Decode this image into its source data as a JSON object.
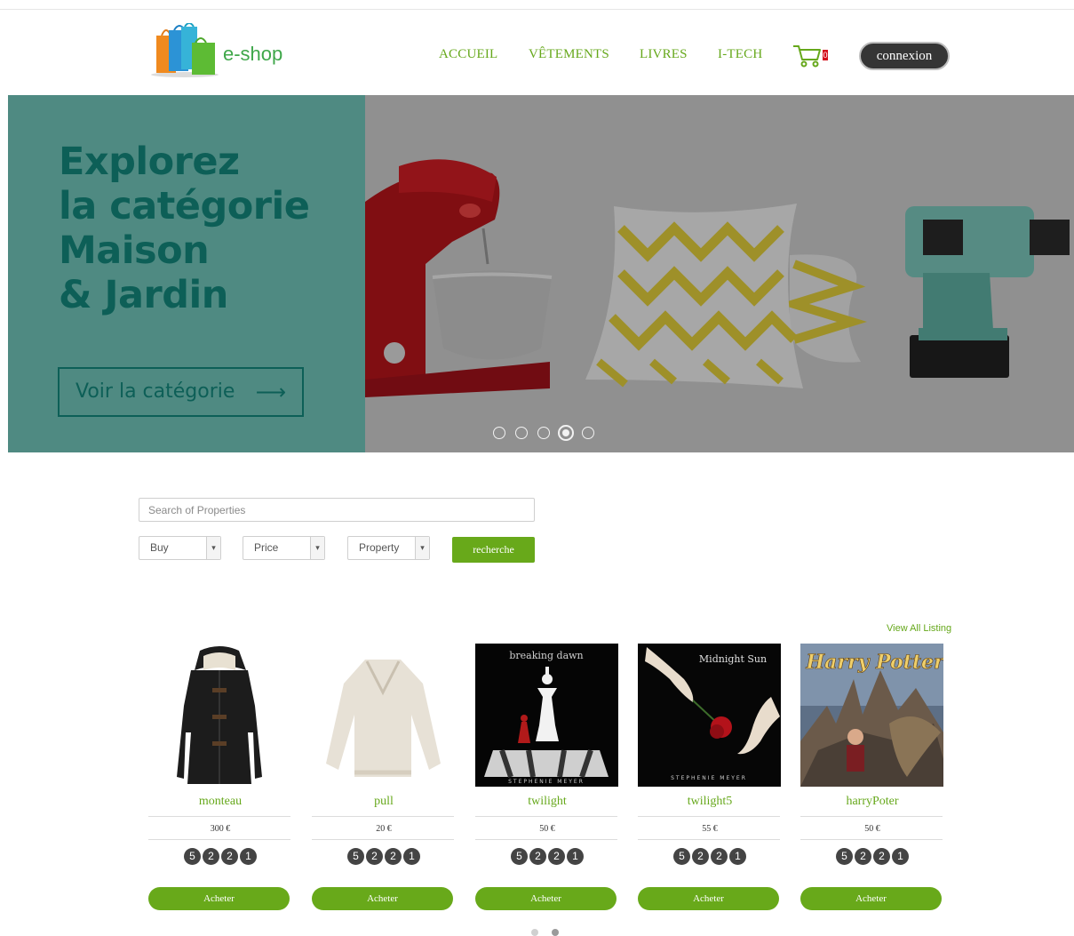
{
  "brand": {
    "name": "e-shop"
  },
  "nav": [
    {
      "label": "ACCUEIL"
    },
    {
      "label": "VÊTEMENTS"
    },
    {
      "label": "LIVRES"
    },
    {
      "label": "I-TECH"
    }
  ],
  "cart": {
    "count": "0",
    "icon": "cart-icon"
  },
  "header": {
    "login_label": "connexion"
  },
  "hero": {
    "title_lines": [
      "Explorez",
      "la catégorie",
      "Maison",
      "& Jardin"
    ],
    "cta_label": "Voir la catégorie",
    "cta_arrow": "⟶",
    "slides": 5,
    "active_slide": 4
  },
  "search": {
    "placeholder": "Search of Properties",
    "filters": [
      {
        "value": "Buy"
      },
      {
        "value": "Price"
      },
      {
        "value": "Property"
      }
    ],
    "submit_label": "recherche"
  },
  "listing": {
    "view_all": "View All Listing",
    "products": [
      {
        "name": "monteau",
        "price": "300 €",
        "ratings": [
          "5",
          "2",
          "2",
          "1"
        ],
        "cta": "Acheter"
      },
      {
        "name": "pull",
        "price": "20 €",
        "ratings": [
          "5",
          "2",
          "2",
          "1"
        ],
        "cta": "Acheter"
      },
      {
        "name": "twilight",
        "price": "50 €",
        "ratings": [
          "5",
          "2",
          "2",
          "1"
        ],
        "cta": "Acheter",
        "cover_title": "breaking dawn",
        "cover_author": "STEPHENIE MEYER"
      },
      {
        "name": "twilight5",
        "price": "55 €",
        "ratings": [
          "5",
          "2",
          "2",
          "1"
        ],
        "cta": "Acheter",
        "cover_title": "Midnight Sun",
        "cover_author": "STEPHENIE MEYER"
      },
      {
        "name": "harryPoter",
        "price": "50 €",
        "ratings": [
          "5",
          "2",
          "2",
          "1"
        ],
        "cta": "Acheter",
        "cover_title": "Harry Potter"
      }
    ]
  },
  "colors": {
    "accent": "#68a91a",
    "teal": "#4f8a82",
    "dark_teal": "#0d5f57"
  }
}
